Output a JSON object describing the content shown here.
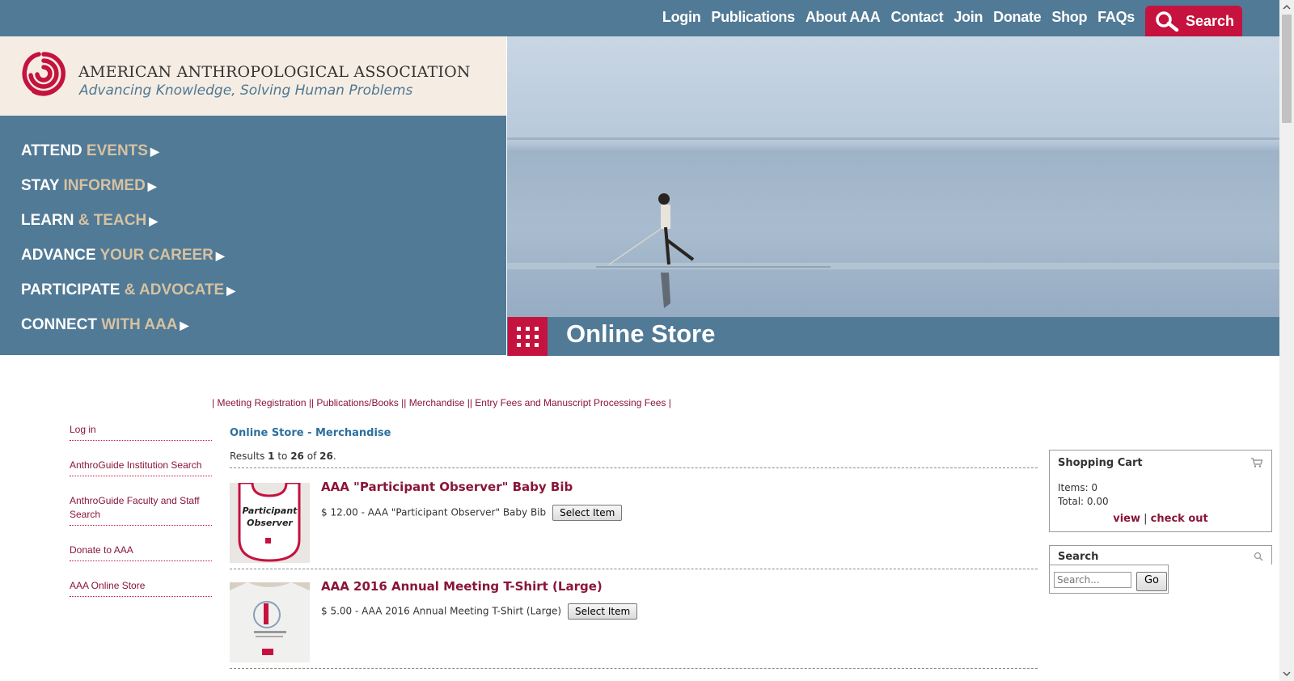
{
  "topnav": {
    "links": [
      "Login",
      "Publications",
      "About AAA",
      "Contact",
      "Join",
      "Donate",
      "Shop",
      "FAQs"
    ],
    "search_label": "Search"
  },
  "logo": {
    "title": "AMERICAN ANTHROPOLOGICAL ASSOCIATION",
    "tagline": "Advancing Knowledge, Solving Human Problems"
  },
  "leftnav": [
    {
      "main": "ATTEND",
      "accent": " EVENTS"
    },
    {
      "main": "STAY",
      "accent": " INFORMED"
    },
    {
      "main": "LEARN",
      "accent": " & TEACH"
    },
    {
      "main": "ADVANCE",
      "accent": " YOUR CAREER"
    },
    {
      "main": "PARTICIPATE",
      "accent": " & ADVOCATE"
    },
    {
      "main": "CONNECT",
      "accent": " WITH AAA"
    }
  ],
  "hero": {
    "title": "Online Store"
  },
  "categories": {
    "text": "| Meeting Registration || Publications/Books || Merchandise || Entry Fees and Manuscript Processing Fees |"
  },
  "sidelinks": [
    "Log in",
    "AnthroGuide Institution Search",
    "AnthroGuide Faculty and Staff Search",
    "Donate to AAA",
    "AAA Online Store"
  ],
  "main": {
    "heading": "Online Store - Merchandise",
    "results_prefix": "Results ",
    "results_from": "1",
    "results_to_word": " to ",
    "results_to": "26",
    "results_of_word": " of ",
    "results_total": "26",
    "results_suffix": "."
  },
  "products": [
    {
      "title": "AAA \"Participant Observer\" Baby Bib",
      "line": "$ 12.00 - AAA \"Participant Observer\" Baby Bib",
      "button": "Select Item",
      "image_text": [
        "Participant",
        "Observer"
      ]
    },
    {
      "title": "AAA 2016 Annual Meeting T-Shirt (Large)",
      "line": "$ 5.00 - AAA 2016 Annual Meeting T-Shirt (Large)",
      "button": "Select Item"
    }
  ],
  "cart": {
    "title": "Shopping Cart",
    "items": "Items: 0",
    "total": "Total: 0.00",
    "view": "view",
    "sep": " | ",
    "checkout": "check out"
  },
  "search_box": {
    "title": "Search",
    "placeholder": "Search...",
    "go": "Go"
  },
  "colors": {
    "brand_blue": "#517a96",
    "brand_red": "#c5123f",
    "link_maroon": "#8a1538",
    "cream": "#f5ede3",
    "accent_tan": "#d6c2a1"
  }
}
